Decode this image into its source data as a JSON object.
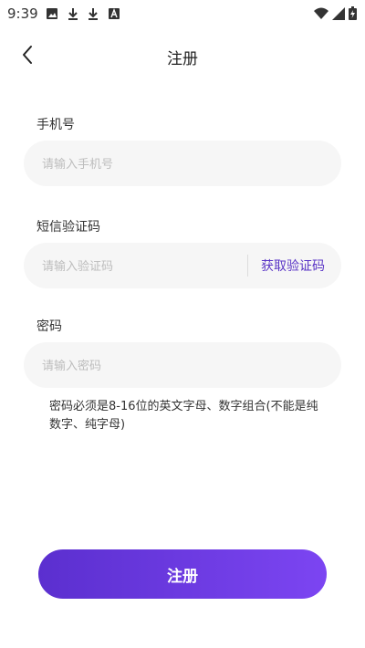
{
  "status_bar": {
    "time": "9:39",
    "left_icons": [
      "image-icon",
      "download-icon",
      "download-icon",
      "text-a-icon"
    ],
    "right_icons": [
      "wifi-icon",
      "signal-icon",
      "battery-icon"
    ]
  },
  "nav": {
    "back_icon": "chevron-left-icon",
    "title": "注册"
  },
  "form": {
    "phone": {
      "label": "手机号",
      "placeholder": "请输入手机号",
      "value": ""
    },
    "code": {
      "label": "短信验证码",
      "placeholder": "请输入验证码",
      "value": "",
      "get_code_label": "获取验证码"
    },
    "password": {
      "label": "密码",
      "placeholder": "请输入密码",
      "value": ""
    },
    "hint": "密码必须是8-16位的英文字母、数字组合(不能是纯数字、纯字母)"
  },
  "submit_label": "注册",
  "colors": {
    "accent": "#5a35c6",
    "button_gradient_start": "#5b2fcf",
    "button_gradient_end": "#7c45f2",
    "field_bg": "#f6f6f6"
  }
}
